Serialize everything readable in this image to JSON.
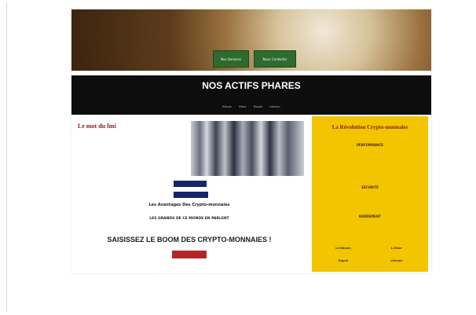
{
  "hero": {
    "title": "",
    "subtitle": "",
    "buttons": [
      "Nos Services",
      "Nous Contacter"
    ]
  },
  "band": {
    "title": "NOS ACTIFS PHARES",
    "subtitle": "",
    "links": [
      "Bitcoin",
      "Ether",
      "Ripple",
      "Litecoin"
    ]
  },
  "mot": {
    "title": "Le mot du fmi",
    "text": "",
    "author": "",
    "role": ""
  },
  "buttons": {
    "btn1": "",
    "btn2": "",
    "cta": ""
  },
  "sections": [
    {
      "title": "Les Avantages Des Crypto-monnaies",
      "text": ""
    },
    {
      "title": "LES GRANDS DE CE MONDE EN PARLENT",
      "text": ""
    }
  ],
  "boom_title": "SAISISSEZ LE BOOM DES CRYPTO-MONNAIES !",
  "side": {
    "title": "La Révolution Crypto-monnaies",
    "intro": "",
    "blocks": [
      {
        "title": "PERFORMANCE",
        "text": ""
      },
      {
        "title": "SÉCURITÉ",
        "text": ""
      },
      {
        "title": "RENDEMENT",
        "text": ""
      }
    ],
    "cells": [
      {
        "label": "Le Bitcoin",
        "value": ""
      },
      {
        "label": "L'Ether",
        "value": ""
      },
      {
        "label": "Ripple",
        "value": ""
      },
      {
        "label": "Litecoin",
        "value": ""
      }
    ]
  },
  "colors": {
    "navy": "#16246a",
    "accent_red": "#b2262a",
    "gold": "#f2c500",
    "band": "#0d0d0d",
    "hero_green": "#2e6b2e"
  }
}
